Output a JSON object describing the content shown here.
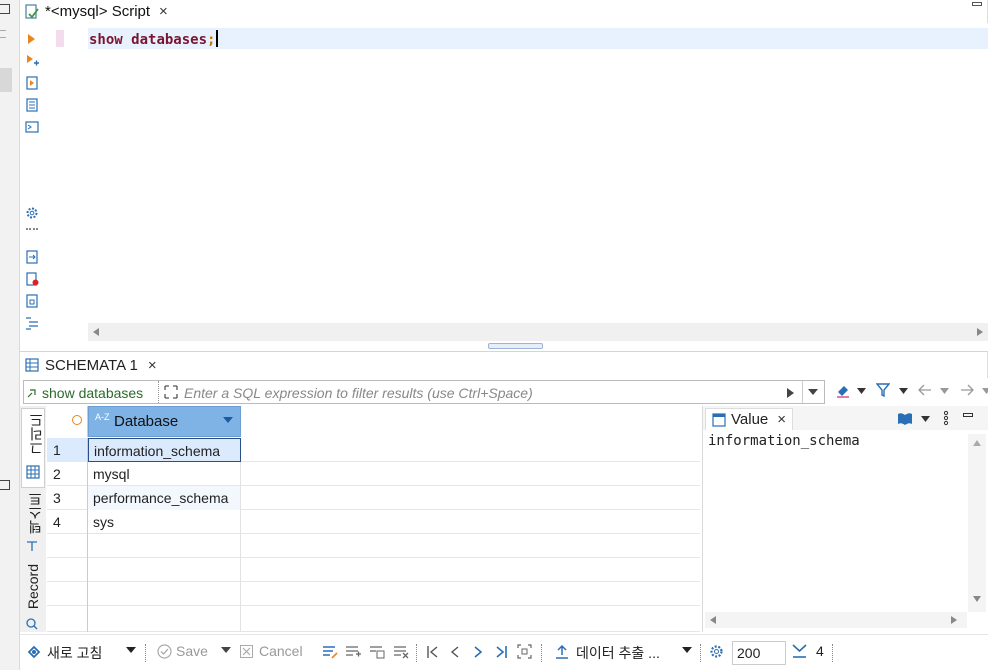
{
  "editor_tab": {
    "title": "*<mysql> Script",
    "close": "×"
  },
  "editor": {
    "sql_keyword1": "show",
    "sql_keyword2": "databases",
    "sql_end": ";"
  },
  "results_tab": {
    "title": "SCHEMATA 1",
    "close": "×"
  },
  "filter": {
    "query_label": "show databases",
    "placeholder": "Enter a SQL expression to filter results (use Ctrl+Space)"
  },
  "side_tabs": {
    "grid": "그리드",
    "text": "텍스트",
    "record": "Record"
  },
  "grid": {
    "column": {
      "sort_badge": "A-Z",
      "name": "Database"
    },
    "rows": [
      {
        "num": "1",
        "value": "information_schema"
      },
      {
        "num": "2",
        "value": "mysql"
      },
      {
        "num": "3",
        "value": "performance_schema"
      },
      {
        "num": "4",
        "value": "sys"
      }
    ]
  },
  "value_panel": {
    "title": "Value",
    "close": "×",
    "content": "information_schema"
  },
  "bottom": {
    "refresh": "새로 고침",
    "save": "Save",
    "cancel": "Cancel",
    "export": "데이터 추출 ...",
    "fetch_size": "200",
    "row_count": "4"
  },
  "colors": {
    "keyword": "#7a1530",
    "header_bg": "#7fb3e6",
    "current_line": "#e8f2fe",
    "selected_cell": "#dbeafc",
    "filter_text": "#2b6b2b"
  }
}
